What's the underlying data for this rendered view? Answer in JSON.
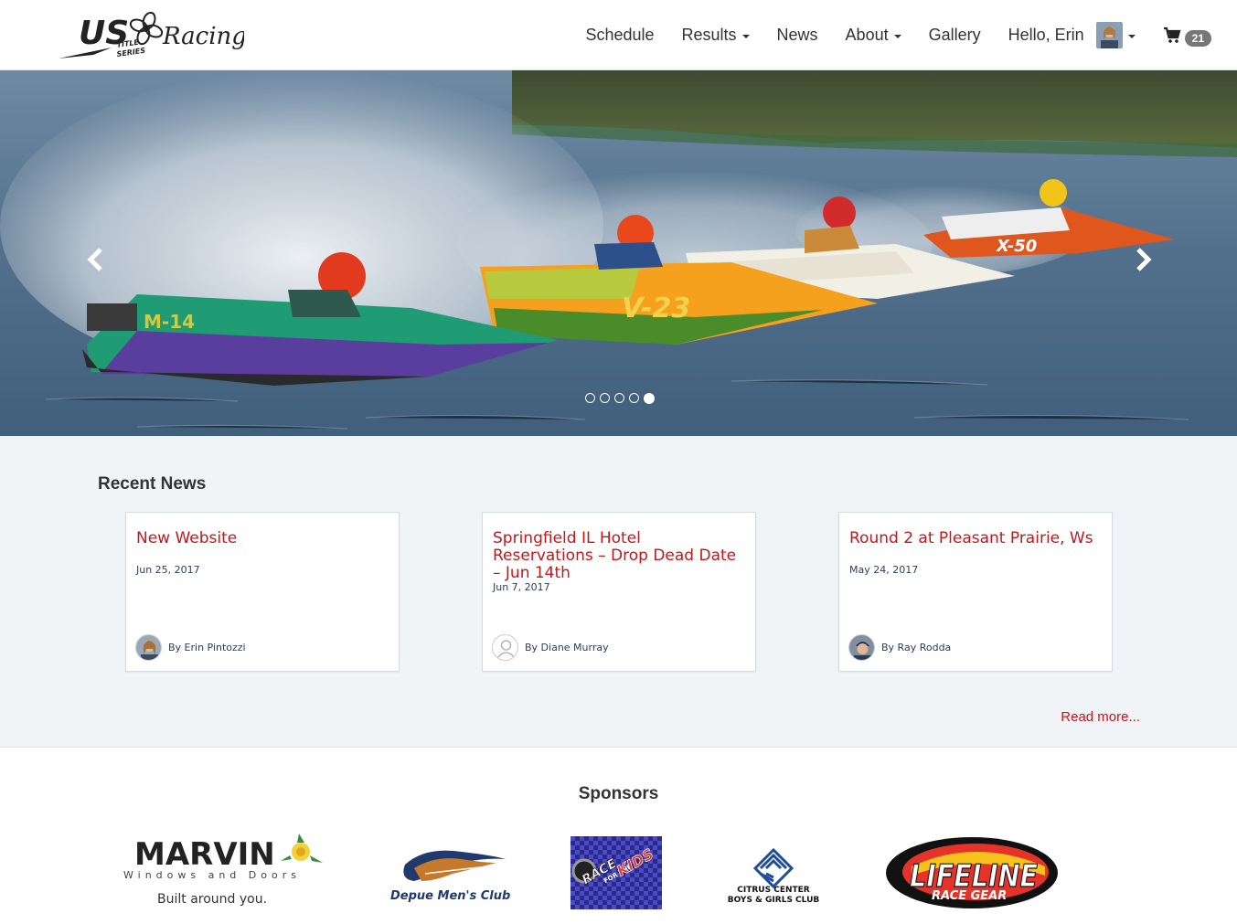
{
  "brand": {
    "logo_initials": "US",
    "logo_word": "Racing",
    "logo_sub": "TITLE SERIES"
  },
  "nav": {
    "schedule": "Schedule",
    "results": "Results",
    "news": "News",
    "about": "About",
    "gallery": "Gallery",
    "greeting": "Hello, Erin",
    "cart_count": "21"
  },
  "hero": {
    "slides": 5,
    "active_slide": 5,
    "boat_numbers": [
      "M-14",
      "V-23",
      "X-50"
    ]
  },
  "news": {
    "section_title": "Recent News",
    "read_more": "Read more...",
    "items": [
      {
        "title": "New Website",
        "date": "Jun 25, 2017",
        "author": "By Erin Pintozzi"
      },
      {
        "title": "Springfield IL Hotel Reservations – Drop Dead Date – Jun 14th",
        "date": "Jun 7, 2017",
        "author": "By Diane Murray"
      },
      {
        "title": "Round 2 at Pleasant Prairie, Ws",
        "date": "May 24, 2017",
        "author": "By Ray Rodda"
      }
    ]
  },
  "sponsors": {
    "title": "Sponsors",
    "items": [
      {
        "name": "MARVIN",
        "line2": "Windows and Doors",
        "line3": "Built around you."
      },
      {
        "name": "Depue Men's Club"
      },
      {
        "name": "RACE FOR THE KIDS",
        "line2": "FOR THE",
        "line3": "KIDS"
      },
      {
        "name": "CITRUS CENTER",
        "line2": "BOYS & GIRLS CLUB"
      },
      {
        "name": "LIFELINE",
        "line2": "RACE GEAR"
      }
    ]
  },
  "colors": {
    "accent": "#c0191c",
    "navy": "#2c3e5c",
    "news_bg": "#f0f4f7"
  }
}
